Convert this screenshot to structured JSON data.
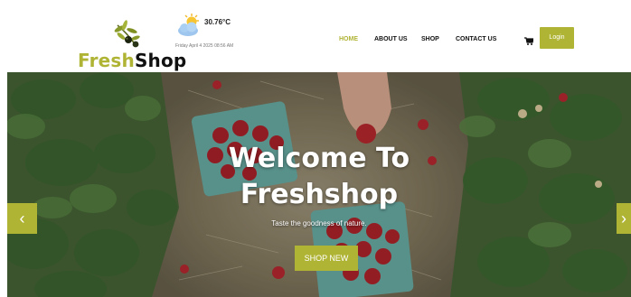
{
  "header": {
    "logo": {
      "part1": "Fresh",
      "part2": "Shop"
    },
    "weather": {
      "icon": "partly-cloudy-icon",
      "temperature": "30.76°C",
      "datetime": "Friday April 4 2025 08:56 AM"
    },
    "nav": {
      "items": [
        {
          "label": "HOME",
          "active": true
        },
        {
          "label": "ABOUT US",
          "active": false
        },
        {
          "label": "SHOP",
          "active": false
        },
        {
          "label": "CONTACT US",
          "active": false
        }
      ],
      "cart_icon": "cart-icon",
      "login_label": "Login"
    }
  },
  "hero": {
    "title_line1": "Welcome To",
    "title_line2": "Freshshop",
    "tagline": "Taste the goodness of nature.",
    "button_label": "SHOP NEW",
    "prev_icon": "chevron-left-icon",
    "next_icon": "chevron-right-icon"
  },
  "colors": {
    "accent": "#b0b435",
    "text_dark": "#111111"
  }
}
